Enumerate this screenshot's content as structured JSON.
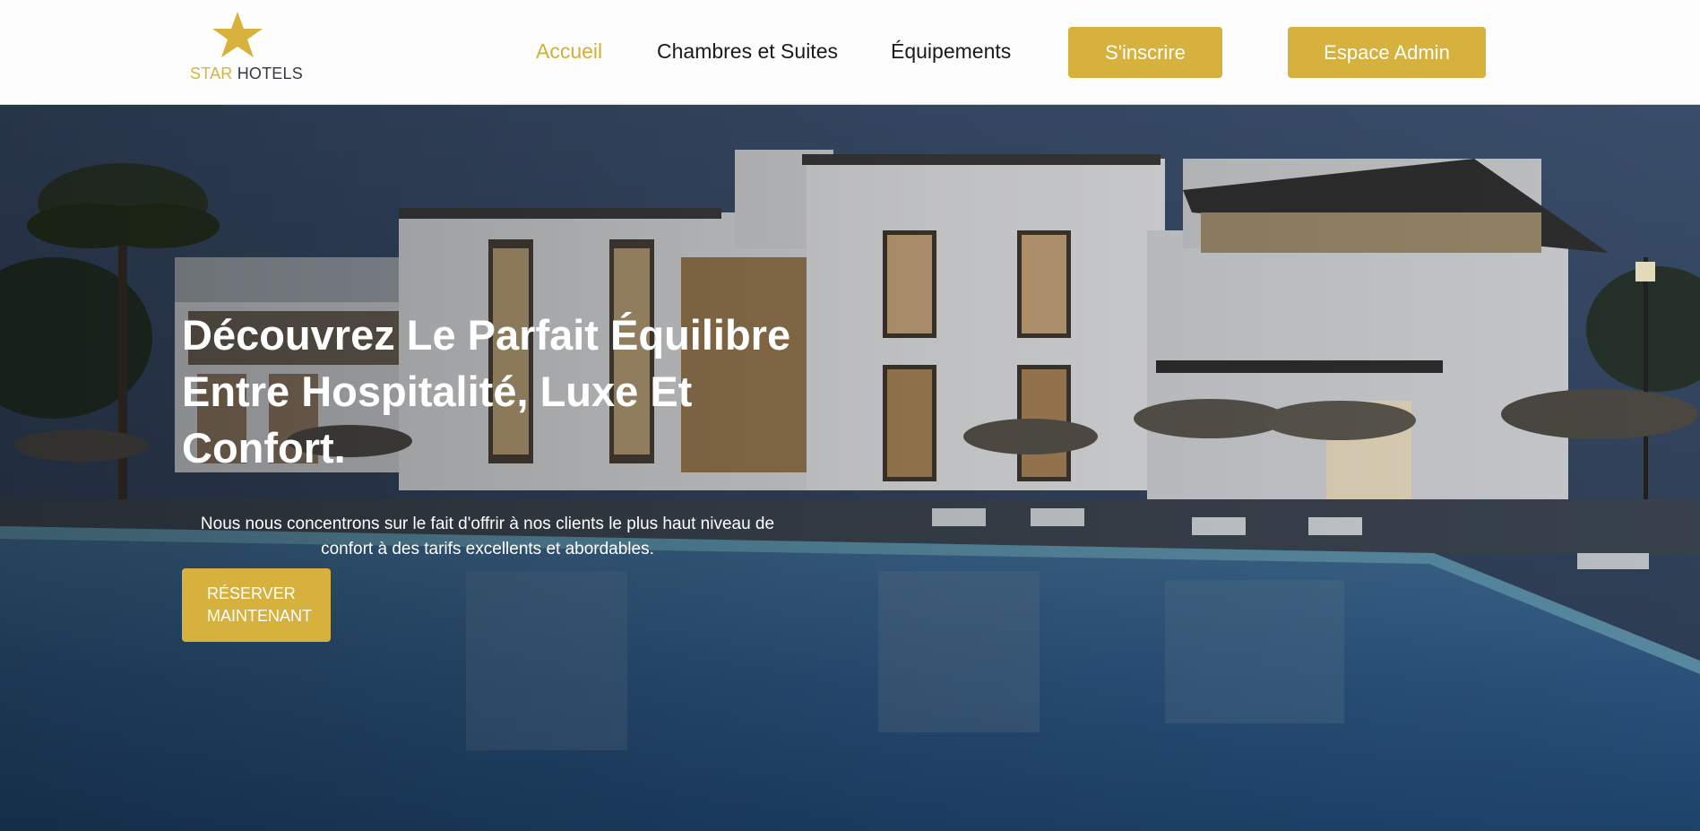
{
  "brand": {
    "logo_icon": "star-icon",
    "name_part1": "STAR",
    "name_part2": "HOTELS",
    "accent_color": "#d4af37"
  },
  "nav": {
    "links": [
      {
        "label": "Accueil",
        "active": true
      },
      {
        "label": "Chambres et Suites",
        "active": false
      },
      {
        "label": "Équipements",
        "active": false
      }
    ],
    "signup_label": "S'inscrire",
    "admin_label": "Espace Admin"
  },
  "hero": {
    "title": "Découvrez Le Parfait Équilibre Entre Hospitalité, Luxe Et Confort.",
    "subtitle": "Nous nous concentrons sur le fait d'offrir à nos clients le plus haut niveau de confort à des tarifs excellents et abordables.",
    "cta_label": "RÉSERVER MAINTENANT"
  }
}
